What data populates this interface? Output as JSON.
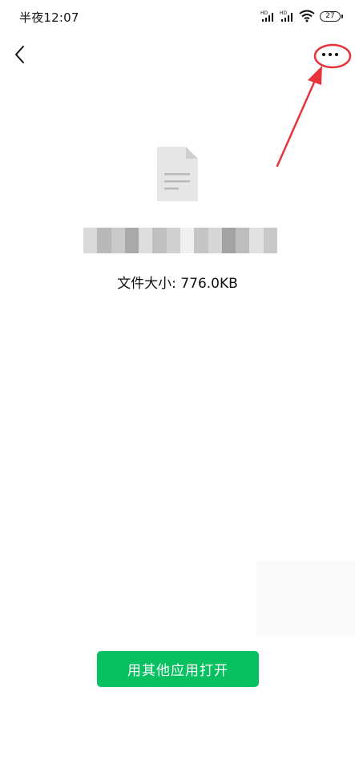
{
  "status_bar": {
    "time": "半夜12:07",
    "battery": "27",
    "signal_1_label": "HD",
    "signal_2_label": "HD"
  },
  "nav": {
    "back_icon": "chevron-left-icon",
    "more_icon": "more-dots-icon"
  },
  "file": {
    "icon": "document-icon",
    "name": "",
    "size_text": "文件大小: 776.0KB"
  },
  "actions": {
    "open_with_other_app": "用其他应用打开"
  },
  "colors": {
    "primary_button": "#07c160",
    "annotation_red": "#e8323c",
    "file_icon_gray": "#e6e6e6"
  }
}
